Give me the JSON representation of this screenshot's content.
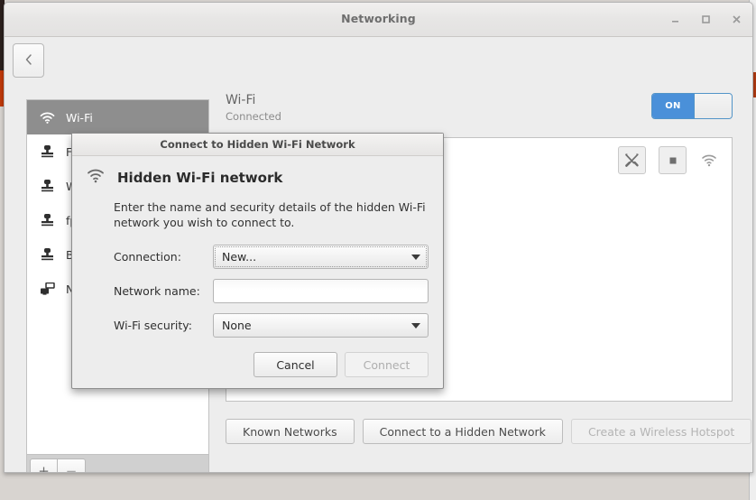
{
  "window": {
    "title": "Networking",
    "buttons": {
      "minimize": "minimize-icon",
      "maximize": "maximize-icon",
      "close": "close-icon"
    },
    "back_button_icon": "chevron-left-icon"
  },
  "sidebar": {
    "items": [
      {
        "label": "Wi-Fi",
        "icon": "wifi-icon",
        "selected": true
      },
      {
        "label": "Fr",
        "icon": "wired-network-icon",
        "selected": false
      },
      {
        "label": "W",
        "icon": "wired-network-icon",
        "selected": false
      },
      {
        "label": "fp",
        "icon": "wired-network-icon",
        "selected": false
      },
      {
        "label": "B",
        "icon": "wired-network-icon",
        "selected": false
      },
      {
        "label": "N",
        "icon": "vpn-network-icon",
        "selected": false
      }
    ],
    "add_label": "+",
    "remove_label": "−"
  },
  "panel": {
    "title": "Wi-Fi",
    "status": "Connected",
    "toggle": {
      "state_label": "ON",
      "on": true,
      "accent": "#4a90d9"
    },
    "tools": [
      {
        "name": "configure-icon",
        "type": "button"
      },
      {
        "name": "stop-icon",
        "type": "button"
      },
      {
        "name": "wifi-signal-icon",
        "type": "indicator"
      }
    ],
    "actions": [
      {
        "label": "Known Networks",
        "disabled": false
      },
      {
        "label": "Connect to a Hidden Network",
        "disabled": false
      },
      {
        "label": "Create a Wireless Hotspot",
        "disabled": true
      }
    ]
  },
  "dialog": {
    "titlebar": "Connect to Hidden Wi-Fi Network",
    "heading": "Hidden Wi-Fi network",
    "heading_icon": "wifi-icon",
    "description": "Enter the name and security details of the hidden Wi-Fi network you wish to connect to.",
    "fields": {
      "connection": {
        "label": "Connection:",
        "value": "New...",
        "options": [
          "New..."
        ]
      },
      "network_name": {
        "label": "Network name:",
        "value": "",
        "placeholder": ""
      },
      "security": {
        "label": "Wi-Fi security:",
        "value": "None",
        "options": [
          "None"
        ]
      }
    },
    "buttons": {
      "cancel": "Cancel",
      "connect": "Connect",
      "connect_disabled": true
    }
  }
}
